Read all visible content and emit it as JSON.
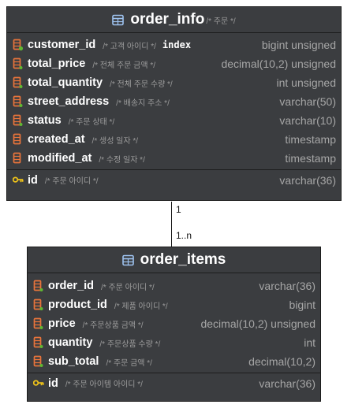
{
  "tables": [
    {
      "name": "order_info",
      "comment": "/* 주문 */",
      "columns": [
        {
          "name": "customer_id",
          "comment": "/* 고객 아이디 */",
          "badge": "index",
          "type": "bigint unsigned",
          "icon": "fk-column-icon"
        },
        {
          "name": "total_price",
          "comment": "/* 전체 주문 금액 */",
          "type": "decimal(10,2) unsigned",
          "icon": "column-icon"
        },
        {
          "name": "total_quantity",
          "comment": "/* 전체 주문 수량 */",
          "type": "int unsigned",
          "icon": "column-icon"
        },
        {
          "name": "street_address",
          "comment": "/* 배송지 주소 */",
          "type": "varchar(50)",
          "icon": "column-icon"
        },
        {
          "name": "status",
          "comment": "/* 주문 상태 */",
          "type": "varchar(10)",
          "icon": "column-icon"
        },
        {
          "name": "created_at",
          "comment": "/* 생성 일자 */",
          "type": "timestamp",
          "icon": "nullable-column-icon"
        },
        {
          "name": "modified_at",
          "comment": "/* 수정 일자 */",
          "type": "timestamp",
          "icon": "nullable-column-icon"
        }
      ],
      "pk": {
        "name": "id",
        "comment": "/* 주문 아이디 */",
        "type": "varchar(36)",
        "icon": "primary-key-icon"
      }
    },
    {
      "name": "order_items",
      "comment": "",
      "columns": [
        {
          "name": "order_id",
          "comment": "/* 주문 아이디 */",
          "type": "varchar(36)",
          "icon": "column-icon"
        },
        {
          "name": "product_id",
          "comment": "/* 제품 아이디 */",
          "type": "bigint",
          "icon": "column-icon"
        },
        {
          "name": "price",
          "comment": "/* 주문상품 금액 */",
          "type": "decimal(10,2) unsigned",
          "icon": "column-icon"
        },
        {
          "name": "quantity",
          "comment": "/* 주문상품 수량 */",
          "type": "int",
          "icon": "column-icon"
        },
        {
          "name": "sub_total",
          "comment": "/* 주문 금액 */",
          "type": "decimal(10,2)",
          "icon": "column-icon"
        }
      ],
      "pk": {
        "name": "id",
        "comment": "/* 주문 아이템 아이디 */",
        "type": "varchar(36)",
        "icon": "primary-key-icon"
      }
    }
  ],
  "relation": {
    "from_cardinality": "1",
    "to_cardinality": "1..n"
  },
  "colors": {
    "header_bg": "#3b3d40",
    "column_icon_orange": "#e8743b",
    "icon_green": "#5fb832",
    "key_gold": "#f0c419",
    "table_icon_blue": "#9ec3f0"
  }
}
